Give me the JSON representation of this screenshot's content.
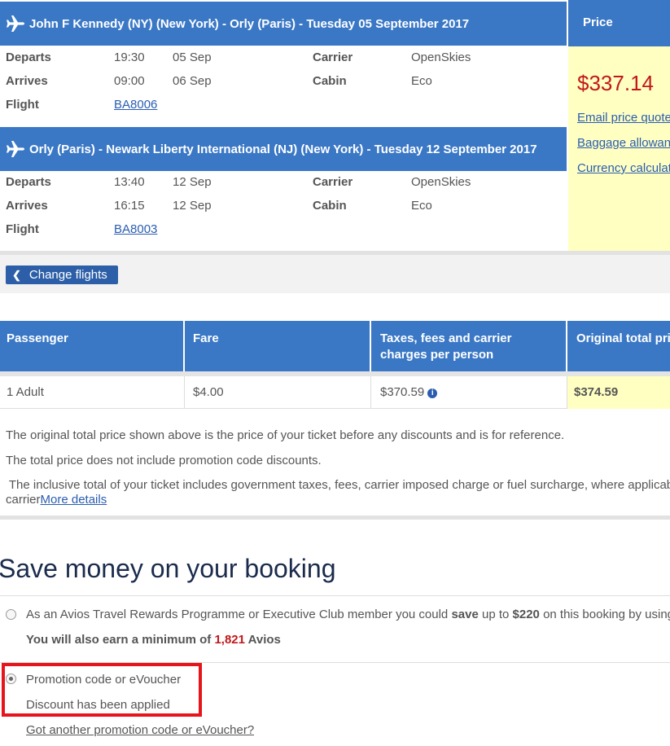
{
  "outbound": {
    "title": "John F Kennedy (NY) (New York) - Orly (Paris) - Tuesday 05 September 2017",
    "departs_label": "Departs",
    "departs_time": "19:30",
    "departs_date": "05 Sep",
    "arrives_label": "Arrives",
    "arrives_time": "09:00",
    "arrives_date": "06 Sep",
    "flight_label": "Flight",
    "flight_number": "BA8006",
    "carrier_label": "Carrier",
    "carrier": "OpenSkies",
    "cabin_label": "Cabin",
    "cabin": "Eco"
  },
  "inbound": {
    "title": "Orly (Paris) - Newark Liberty International (NJ) (New York) - Tuesday 12 September 2017",
    "departs_label": "Departs",
    "departs_time": "13:40",
    "departs_date": "12 Sep",
    "arrives_label": "Arrives",
    "arrives_time": "16:15",
    "arrives_date": "12 Sep",
    "flight_label": "Flight",
    "flight_number": "BA8003",
    "carrier_label": "Carrier",
    "carrier": "OpenSkies",
    "cabin_label": "Cabin",
    "cabin": "Eco"
  },
  "price": {
    "header": "Price",
    "amount": "$337.14",
    "email_link": "Email price quote",
    "baggage_link": "Baggage allowance",
    "currency_link": "Currency calculator"
  },
  "change_flights": "Change flights",
  "fare_table": {
    "headers": [
      "Passenger",
      "Fare",
      "Taxes, fees and carrier charges per person",
      "Original total price"
    ],
    "row": {
      "passenger": "1 Adult",
      "fare": "$4.00",
      "taxes": "$370.59",
      "total": "$374.59"
    }
  },
  "notes": {
    "line1": "The original total price shown above is the price of your ticket before any discounts and is for reference.",
    "line2": "The total price does not include promotion code discounts.",
    "line3": " The inclusive total of your ticket includes government taxes, fees, carrier imposed charge or fuel surcharge, where applicable",
    "line4_prefix": "carrier",
    "more_details": "More details"
  },
  "save": {
    "title": "Save money on your booking",
    "avios_text_1": "As an Avios Travel Rewards Programme or Executive Club member you could ",
    "avios_save": "save",
    "avios_text_2": " up to ",
    "avios_amount": "$220",
    "avios_text_3": " on this booking by using Avios",
    "earn_prefix": "You will also earn a minimum of ",
    "earn_amount": "1,821",
    "earn_suffix": " Avios",
    "promo_label": "Promotion code or eVoucher",
    "promo_status": "Discount has been applied",
    "another_link": "Got another promotion code or eVoucher?"
  },
  "colors": {
    "header_blue": "#3a78c6",
    "price_bg": "#ffffc2",
    "price_red": "#c0181c",
    "highlight": "#e8141c"
  }
}
